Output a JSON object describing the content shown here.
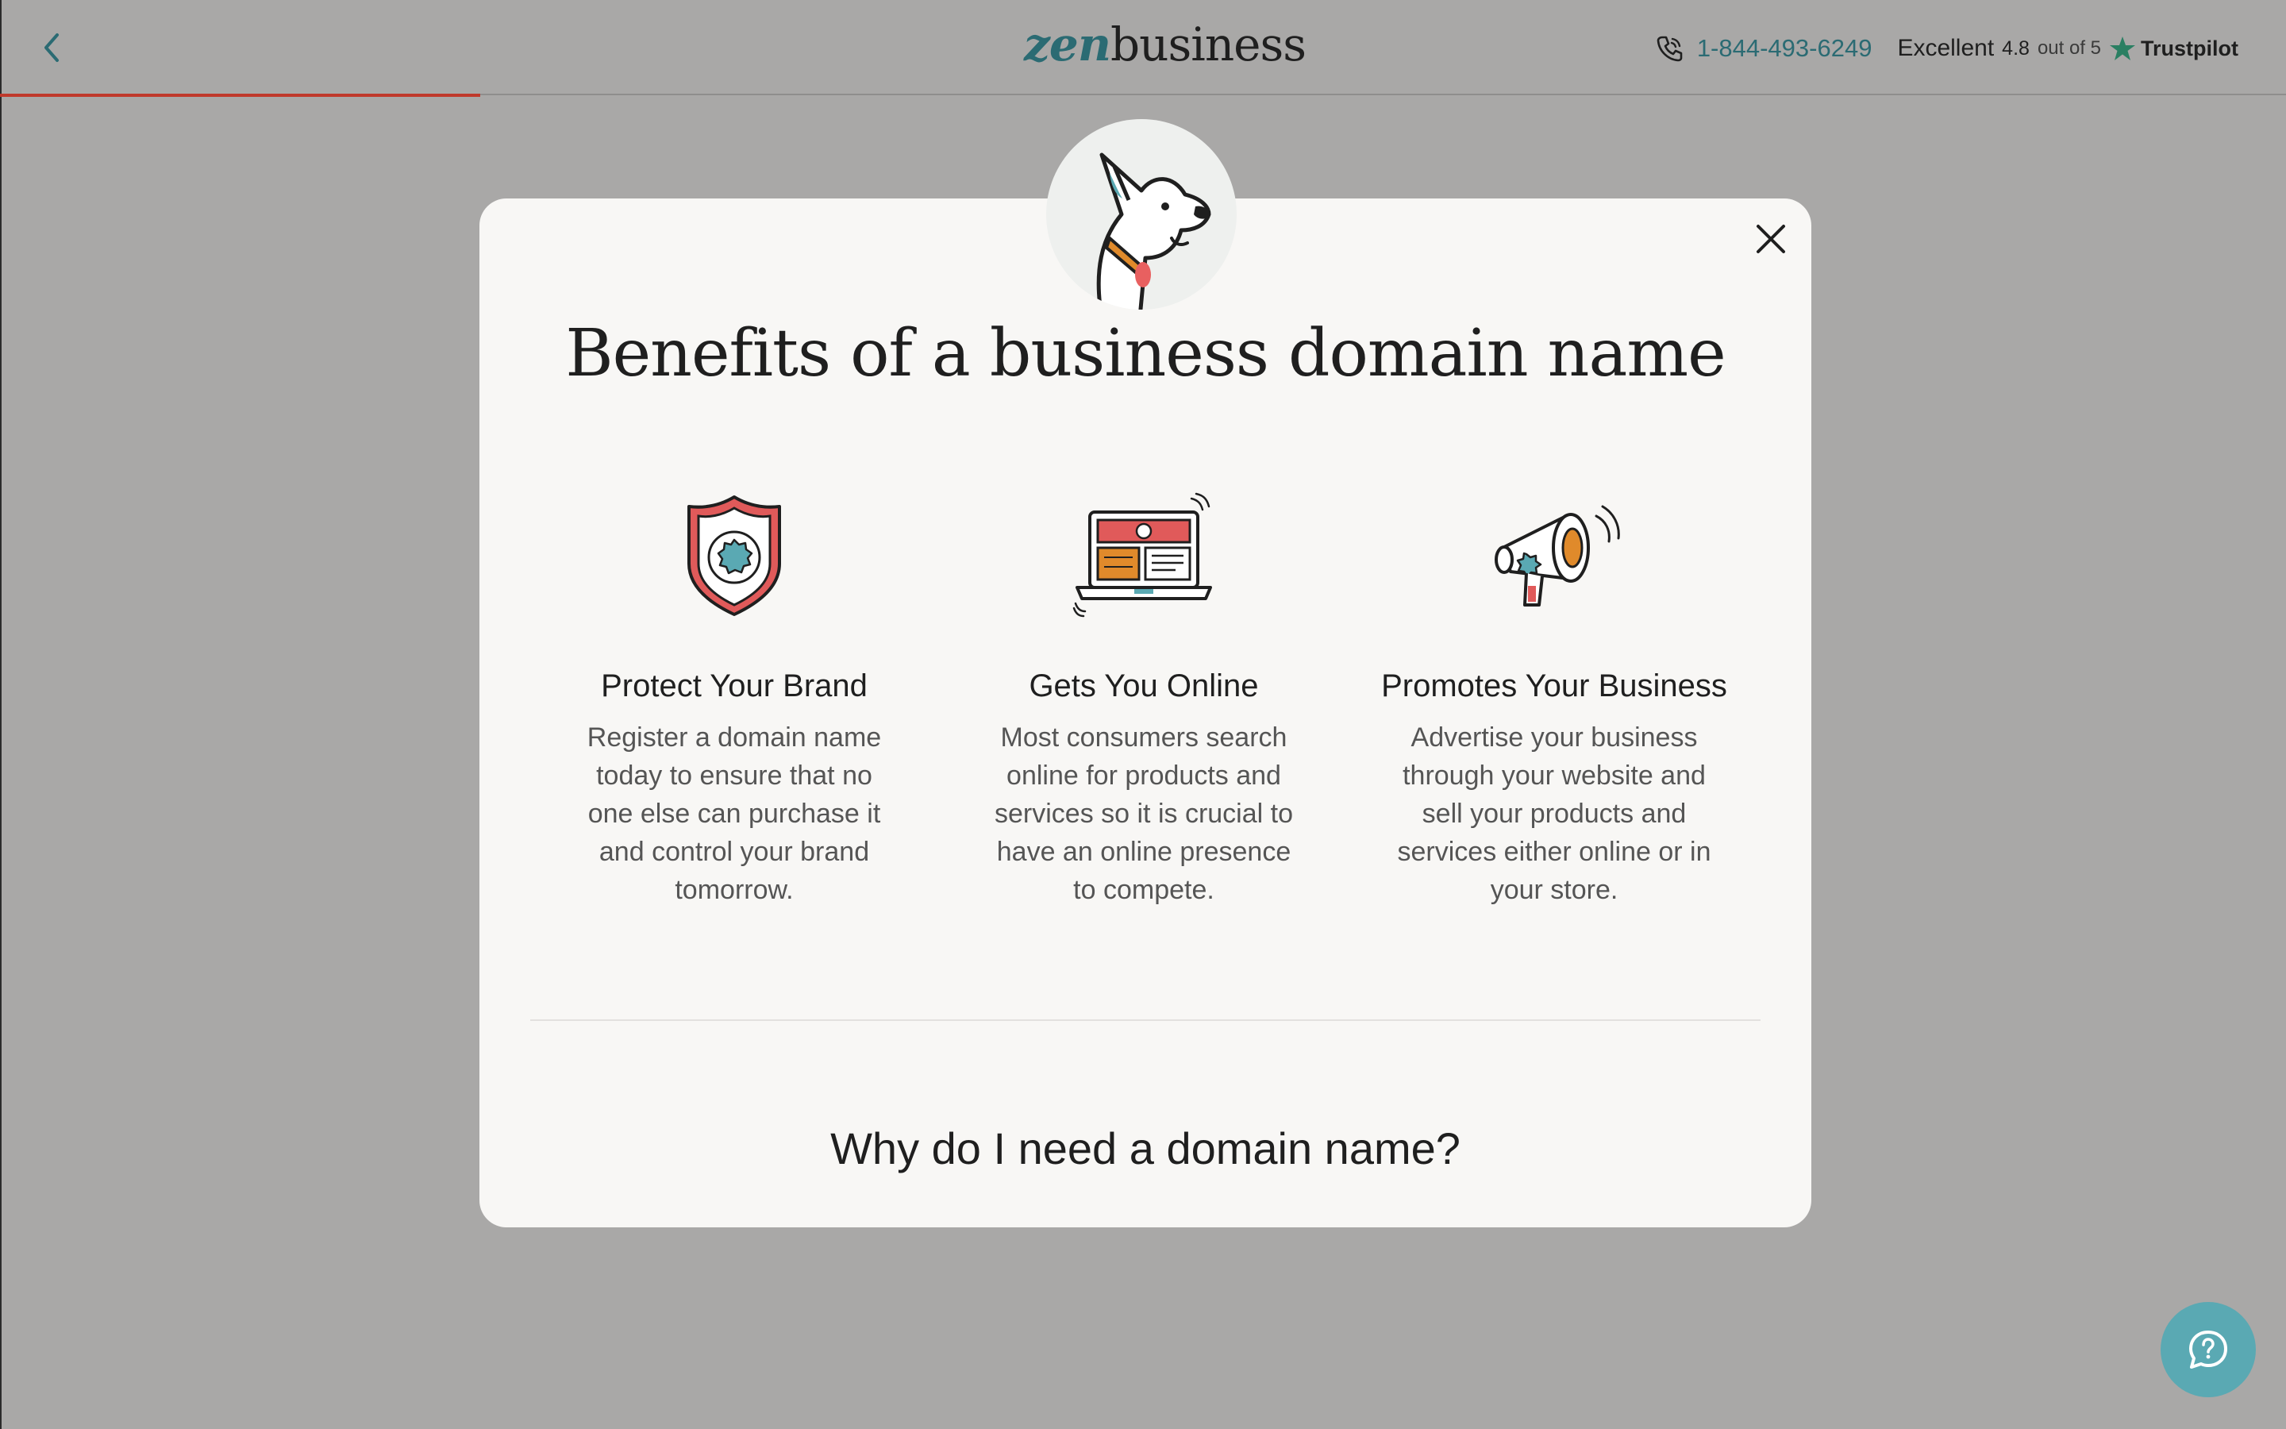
{
  "header": {
    "logo_zen": "zen",
    "logo_business": "business",
    "phone": "1-844-493-6249",
    "rating_word": "Excellent",
    "rating_score": "4.8",
    "rating_outof": "out of 5",
    "trustpilot": "Trustpilot",
    "progress_fraction": 0.21
  },
  "modal": {
    "title": "Benefits of a business domain name",
    "benefits": [
      {
        "heading": "Protect Your Brand",
        "text": "Register a domain name today to ensure that no one else can purchase it and control your brand tomorrow.",
        "icon": "shield-icon"
      },
      {
        "heading": "Gets You Online",
        "text": "Most consumers search online for products and services so it is crucial to have an online presence to compete.",
        "icon": "laptop-icon"
      },
      {
        "heading": "Promotes Your Business",
        "text": "Advertise your business through your website and sell your products and services either online or in your store.",
        "icon": "megaphone-icon"
      }
    ],
    "why_heading": "Why do I need a domain name?"
  },
  "colors": {
    "brand_teal": "#2b6b73",
    "progress_red": "#c0392b",
    "help_button": "#5aa9b3",
    "overlay": "#a9a8a7",
    "modal_bg": "#f8f7f5"
  },
  "icons": {
    "back": "chevron-left-icon",
    "phone": "phone-icon",
    "star": "star-icon",
    "close": "close-icon",
    "help": "chat-question-icon",
    "mascot": "dog-mascot"
  }
}
